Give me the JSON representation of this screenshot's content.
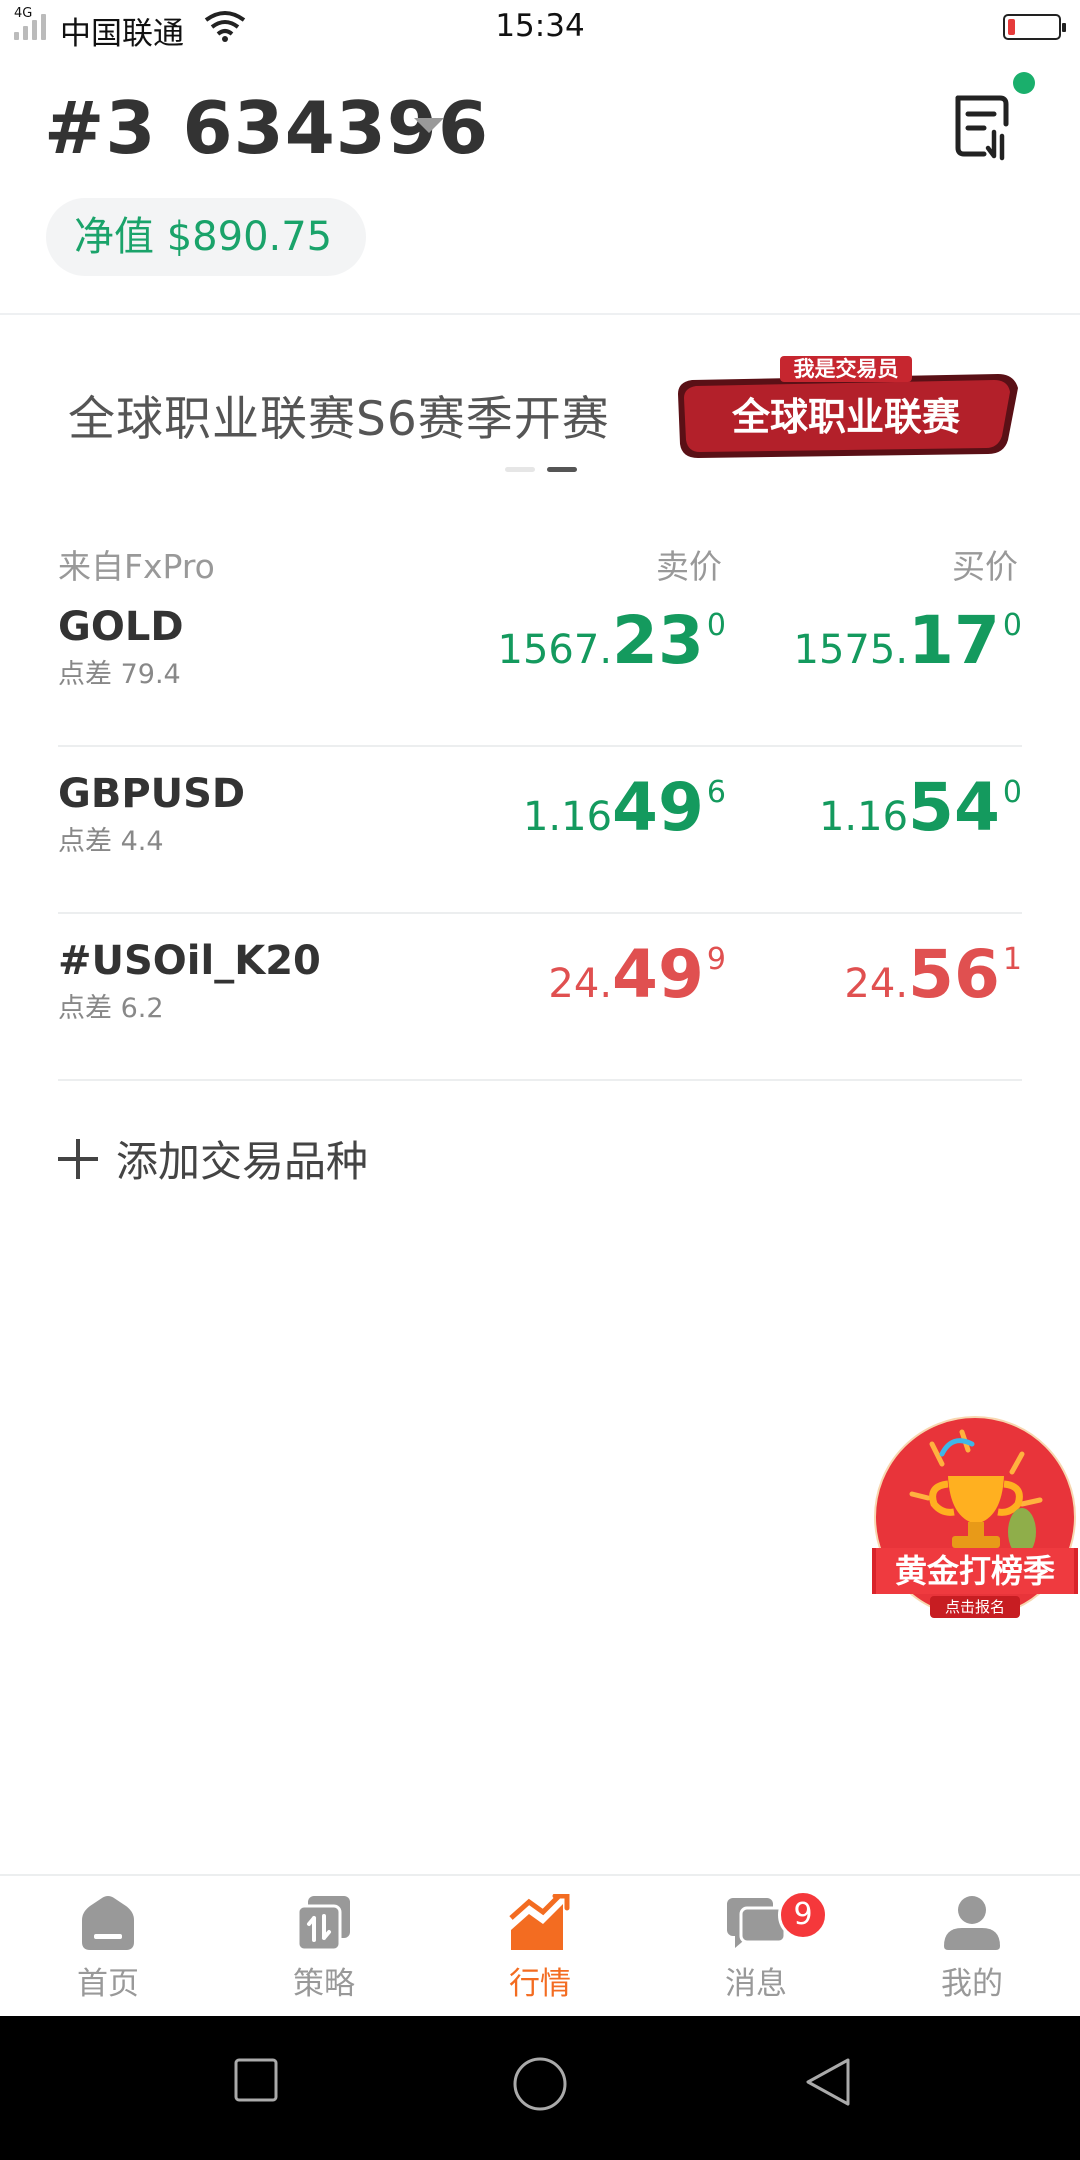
{
  "status_bar": {
    "network_tag": "4G",
    "carrier": "中国联通",
    "time": "15:34"
  },
  "header": {
    "account": "#3 634396",
    "equity_label": "净值",
    "equity_value": "$890.75"
  },
  "banner": {
    "title": "全球职业联赛S6赛季开赛",
    "art_top": "我是交易员",
    "art_main": "全球职业联赛",
    "active_dot": 1
  },
  "quotes": {
    "source_label": "来自FxPro",
    "sell_label": "卖价",
    "buy_label": "买价",
    "rows": [
      {
        "symbol": "GOLD",
        "spread_label": "点差",
        "spread": "79.4",
        "sell": {
          "p1": "1567.",
          "p2": "23",
          "p3": "0"
        },
        "buy": {
          "p1": "1575.",
          "p2": "17",
          "p3": "0"
        },
        "color": "green"
      },
      {
        "symbol": "GBPUSD",
        "spread_label": "点差",
        "spread": "4.4",
        "sell": {
          "p1": "1.16",
          "p2": "49",
          "p3": "6"
        },
        "buy": {
          "p1": "1.16",
          "p2": "54",
          "p3": "0"
        },
        "color": "green"
      },
      {
        "symbol": "#USOil_K20",
        "spread_label": "点差",
        "spread": "6.2",
        "sell": {
          "p1": "24.",
          "p2": "49",
          "p3": "9"
        },
        "buy": {
          "p1": "24.",
          "p2": "56",
          "p3": "1"
        },
        "color": "red"
      }
    ],
    "add_label": "添加交易品种"
  },
  "promo": {
    "title": "黄金打榜季",
    "subtitle": "点击报名"
  },
  "tabs": [
    {
      "label": "首页",
      "icon": "home-icon"
    },
    {
      "label": "策略",
      "icon": "strategy-icon"
    },
    {
      "label": "行情",
      "icon": "market-chart-icon",
      "active": true
    },
    {
      "label": "消息",
      "icon": "message-icon",
      "badge": "9"
    },
    {
      "label": "我的",
      "icon": "profile-icon"
    }
  ],
  "colors": {
    "green": "#149a5e",
    "red": "#e05050",
    "accent": "#f36c21",
    "badge": "#f5383b"
  }
}
